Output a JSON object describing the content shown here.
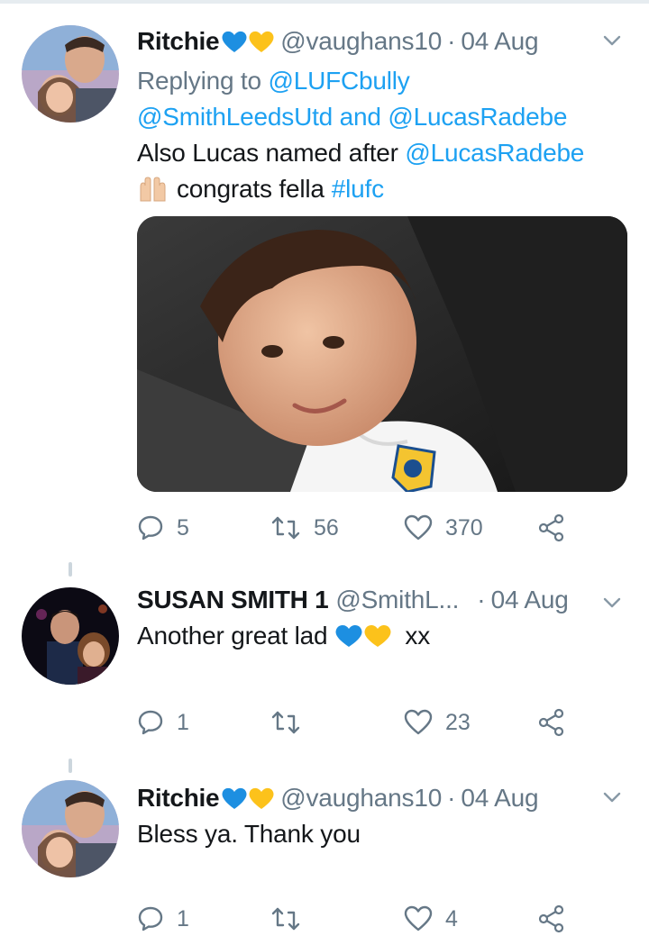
{
  "tweets": [
    {
      "name": "Ritchie",
      "handle": "@vaughans10",
      "dot": "·",
      "time": "04 Aug",
      "replying_prefix": "Replying to",
      "replying_to_1": "@LUFCbully",
      "replying_to_2": "@SmithLeedsUtd",
      "replying_and": "and",
      "replying_to_3": "@LucasRadebe",
      "text_part1": "Also Lucas named after",
      "text_mention": "@LucasRadebe",
      "text_part2": "congrats fella",
      "hashtag": "#lufc",
      "replies": "5",
      "retweets": "56",
      "likes": "370"
    },
    {
      "name": "SUSAN SMITH 1",
      "handle": "@SmithL...",
      "dot": "·",
      "time": "04 Aug",
      "text": "Another great lad",
      "text_suffix": "xx",
      "replies": "1",
      "retweets": "",
      "likes": "23"
    },
    {
      "name": "Ritchie",
      "handle": "@vaughans10",
      "dot": "·",
      "time": "04 Aug",
      "text": "Bless ya. Thank you",
      "replies": "1",
      "retweets": "",
      "likes": "4"
    }
  ],
  "icons": {
    "reply": "reply-icon",
    "retweet": "retweet-icon",
    "like": "heart-icon",
    "share": "share-icon",
    "chevron": "chevron-down-icon"
  },
  "colors": {
    "link": "#1da1f2",
    "muted": "#657786",
    "text": "#14171a",
    "blue_heart": "#1d8fe1",
    "yellow_heart": "#fcc21b"
  }
}
